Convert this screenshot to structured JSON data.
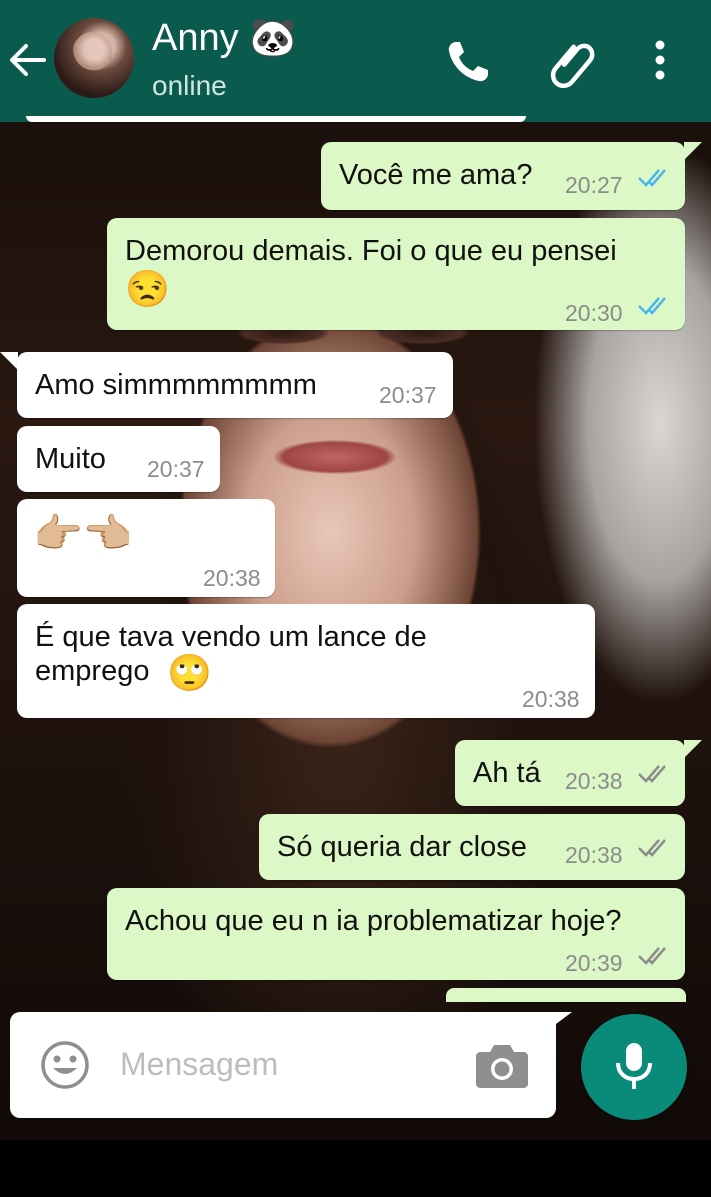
{
  "header": {
    "contact_name": "Anny 🐼",
    "status": "online",
    "back_icon": "arrow-left-icon",
    "call_icon": "phone-icon",
    "attach_icon": "paperclip-icon",
    "menu_icon": "more-vert-icon"
  },
  "messages": [
    {
      "dir": "out",
      "text": "Você me ama?",
      "time": "20:27",
      "read": true
    },
    {
      "dir": "out",
      "text": "Demorou demais. Foi o que eu pensei",
      "emoji": "😒",
      "time": "20:30",
      "read": true
    },
    {
      "dir": "in",
      "text": "Amo simmmmmmmm",
      "time": "20:37"
    },
    {
      "dir": "in",
      "text": "Muito",
      "time": "20:37"
    },
    {
      "dir": "in",
      "text": "",
      "emoji": "👉🏼👈🏼",
      "time": "20:38"
    },
    {
      "dir": "in",
      "text": "É que tava vendo um lance de emprego",
      "emoji": "🙄",
      "time": "20:38"
    },
    {
      "dir": "out",
      "text": "Ah tá",
      "time": "20:38",
      "read": false
    },
    {
      "dir": "out",
      "text": "Só queria dar close",
      "time": "20:38",
      "read": false
    },
    {
      "dir": "out",
      "text": "Achou que eu n ia problematizar hoje?",
      "time": "20:39",
      "read": false
    }
  ],
  "composer": {
    "placeholder": "Mensagem",
    "emoji_icon": "smiley-icon",
    "camera_icon": "camera-icon",
    "mic_icon": "microphone-icon"
  },
  "colors": {
    "header": "#0b5a4e",
    "outgoing_bubble": "#dcf8c6",
    "incoming_bubble": "#ffffff",
    "read_tick": "#4fb6ec",
    "unread_tick": "#8c8c8c",
    "mic_button": "#0a8a78"
  }
}
